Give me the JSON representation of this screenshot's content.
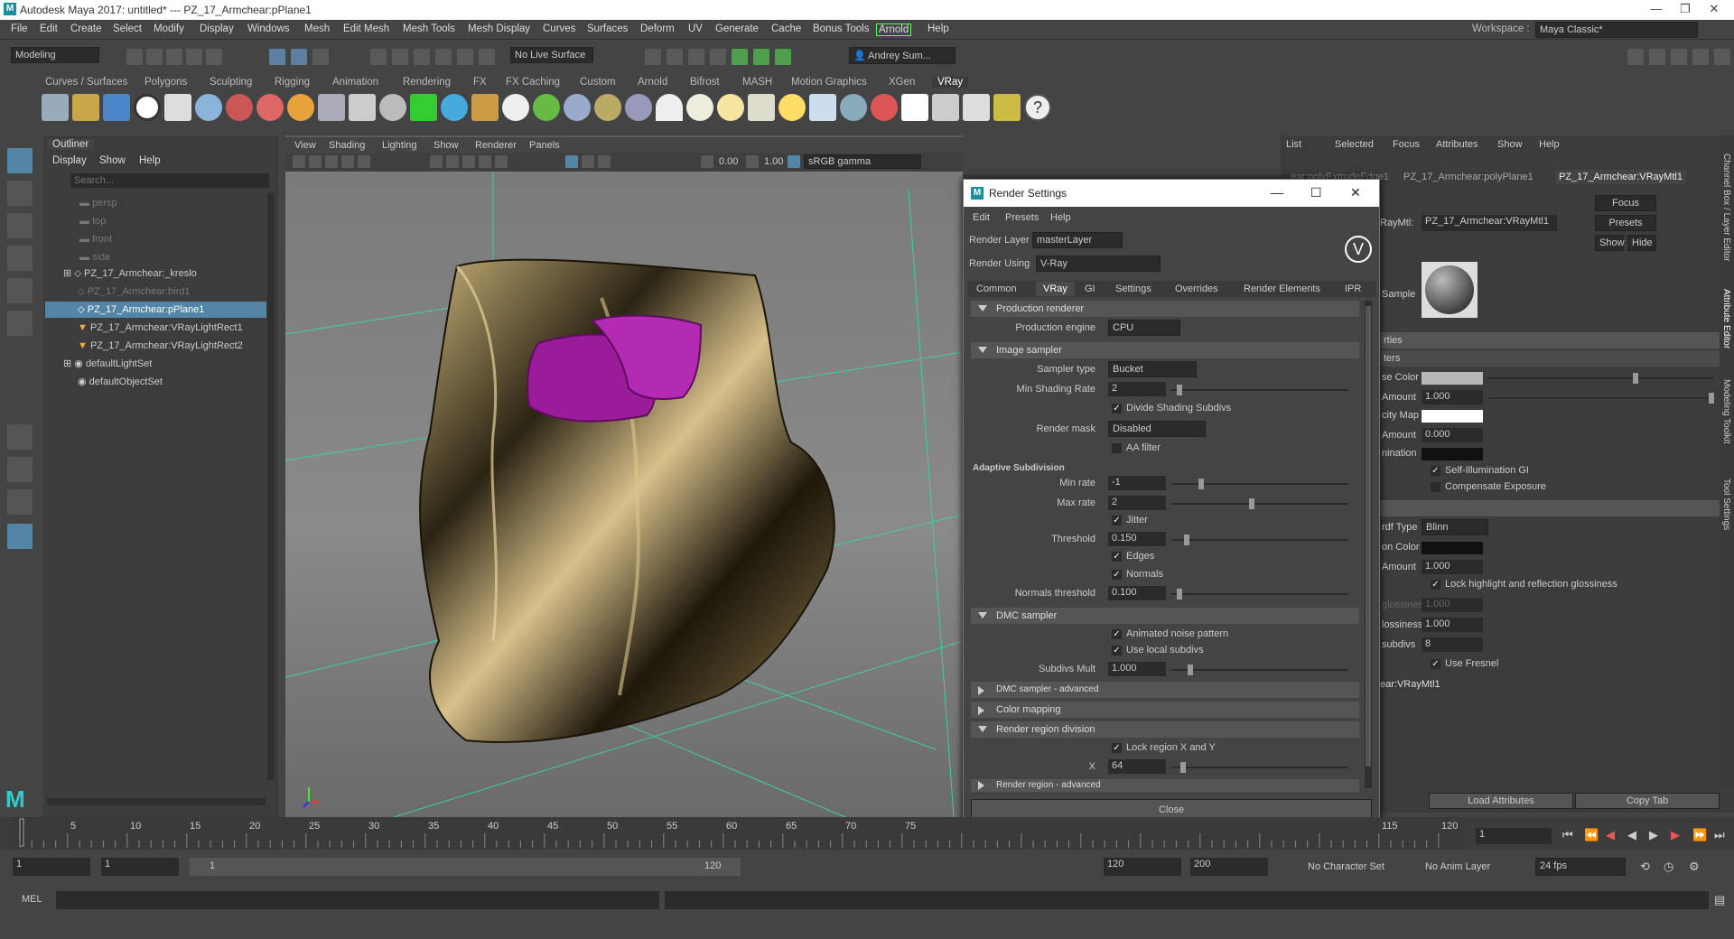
{
  "window": {
    "title": "Autodesk Maya 2017: untitled*   ---   PZ_17_Armchear:pPlane1"
  },
  "menubar": {
    "items": [
      "File",
      "Edit",
      "Create",
      "Select",
      "Modify",
      "Display",
      "Windows",
      "Mesh",
      "Edit Mesh",
      "Mesh Tools",
      "Mesh Display",
      "Curves",
      "Surfaces",
      "Deform",
      "UV",
      "Generate",
      "Cache",
      "Bonus Tools",
      "Arnold",
      "Help"
    ],
    "workspace_label": "Workspace :",
    "workspace_value": "Maya Classic*"
  },
  "status": {
    "mode": "Modeling",
    "live_surface": "No Live Surface",
    "user": "Andrey Sum..."
  },
  "shelf": {
    "tabs": [
      "Curves / Surfaces",
      "Polygons",
      "Sculpting",
      "Rigging",
      "Animation",
      "Rendering",
      "FX",
      "FX Caching",
      "Custom",
      "Arnold",
      "Bifrost",
      "MASH",
      "Motion Graphics",
      "XGen",
      "VRay"
    ],
    "active": "VRay"
  },
  "outliner": {
    "title": "Outliner",
    "menus": [
      "Display",
      "Show",
      "Help"
    ],
    "search_placeholder": "Search...",
    "rows": [
      {
        "label": "persp"
      },
      {
        "label": "top"
      },
      {
        "label": "front"
      },
      {
        "label": "side"
      },
      {
        "label": "PZ_17_Armchear:_kreslo"
      },
      {
        "label": "PZ_17_Armchear:bird1"
      },
      {
        "label": "PZ_17_Armchear:pPlane1"
      },
      {
        "label": "PZ_17_Armchear:VRayLightRect1"
      },
      {
        "label": "PZ_17_Armchear:VRayLightRect2"
      },
      {
        "label": "defaultLightSet"
      },
      {
        "label": "defaultObjectSet"
      }
    ]
  },
  "viewport": {
    "menus": [
      "View",
      "Shading",
      "Lighting",
      "Show",
      "Renderer",
      "Panels"
    ],
    "field_a": "0.00",
    "field_b": "1.00",
    "color_space": "sRGB gamma"
  },
  "render_settings": {
    "title": "Render Settings",
    "menus": [
      "Edit",
      "Presets",
      "Help"
    ],
    "render_layer_label": "Render Layer",
    "render_layer": "masterLayer",
    "render_using_label": "Render Using",
    "render_using": "V-Ray",
    "tabs": [
      "Common",
      "VRay",
      "GI",
      "Settings",
      "Overrides",
      "Render Elements",
      "IPR"
    ],
    "active_tab": "VRay",
    "production_renderer": "Production renderer",
    "production_engine_label": "Production engine",
    "production_engine": "CPU",
    "image_sampler": "Image sampler",
    "sampler_type_label": "Sampler type",
    "sampler_type": "Bucket",
    "min_shading_rate_label": "Min Shading Rate",
    "min_shading_rate": "2",
    "divide_shading": "Divide Shading Subdivs",
    "render_mask_label": "Render mask",
    "render_mask": "Disabled",
    "aa_filter": "AA filter",
    "adaptive": "Adaptive Subdivision",
    "min_rate_label": "Min rate",
    "min_rate": "-1",
    "max_rate_label": "Max rate",
    "max_rate": "2",
    "jitter": "Jitter",
    "threshold_label": "Threshold",
    "threshold": "0.150",
    "edges": "Edges",
    "normals": "Normals",
    "normals_threshold_label": "Normals threshold",
    "normals_threshold": "0.100",
    "dmc_sampler": "DMC sampler",
    "animated_noise": "Animated noise pattern",
    "use_local": "Use local subdivs",
    "subdivs_mult_label": "Subdivs Mult",
    "subdivs_mult": "1.000",
    "dmc_adv": "DMC sampler - advanced",
    "color_mapping": "Color mapping",
    "render_region": "Render region division",
    "lock_region": "Lock region X and Y",
    "x_label": "X",
    "x_value": "64",
    "region_adv": "Render region - advanced",
    "close": "Close"
  },
  "attr": {
    "menus": [
      "List",
      "Selected",
      "Focus",
      "Attributes",
      "Show",
      "Help"
    ],
    "tabs": [
      "...ear:polyExtrudeEdge1",
      "PZ_17_Armchear:polyPlane1",
      "PZ_17_Armchear:VRayMtl1"
    ],
    "node_label": "RayMtl:",
    "node_value": "PZ_17_Armchear:VRayMtl1",
    "focus": "Focus",
    "presets": "Presets",
    "show": "Show",
    "hide": "Hide",
    "sample": "Sample",
    "rows": [
      "rties",
      "ters",
      "se Color",
      "Amount",
      "city Map",
      "Amount",
      "nination"
    ],
    "amount1": "1.000",
    "amount2": "0.000",
    "self_illum": "Self-Illumination GI",
    "comp_exp": "Compensate Exposure",
    "brdf_label": "rdf Type",
    "brdf": "Blinn",
    "on_color": "on Color",
    "amount3": "1.000",
    "lock_hl": "Lock highlight and reflection glossiness",
    "gloss1_label": "glossiness",
    "gloss1": "1.000",
    "gloss2_label": "lossiness",
    "gloss2": "1.000",
    "subdivs_label": "subdivs",
    "subdivs": "8",
    "fresnel": "Use Fresnel",
    "footer_node": "ear:VRayMtl1",
    "load_attr": "Load Attributes",
    "copy_tab": "Copy Tab",
    "side_tabs": [
      "Channel Box / Layer Editor",
      "Attribute Editor",
      "Modeling Toolkit",
      "Tool Settings"
    ]
  },
  "timeline": {
    "ticks": [
      "5",
      "10",
      "15",
      "20",
      "25",
      "30",
      "35",
      "40",
      "45",
      "50",
      "55",
      "60",
      "65",
      "70",
      "75",
      "115",
      "120"
    ],
    "current": "1"
  },
  "range": {
    "start": "1",
    "start2": "1",
    "bar_start": "1",
    "bar_end": "120",
    "end": "120",
    "end2": "200",
    "char_set": "No Character Set",
    "anim_layer": "No Anim Layer",
    "fps": "24 fps"
  },
  "cmd": {
    "mel": "MEL"
  }
}
